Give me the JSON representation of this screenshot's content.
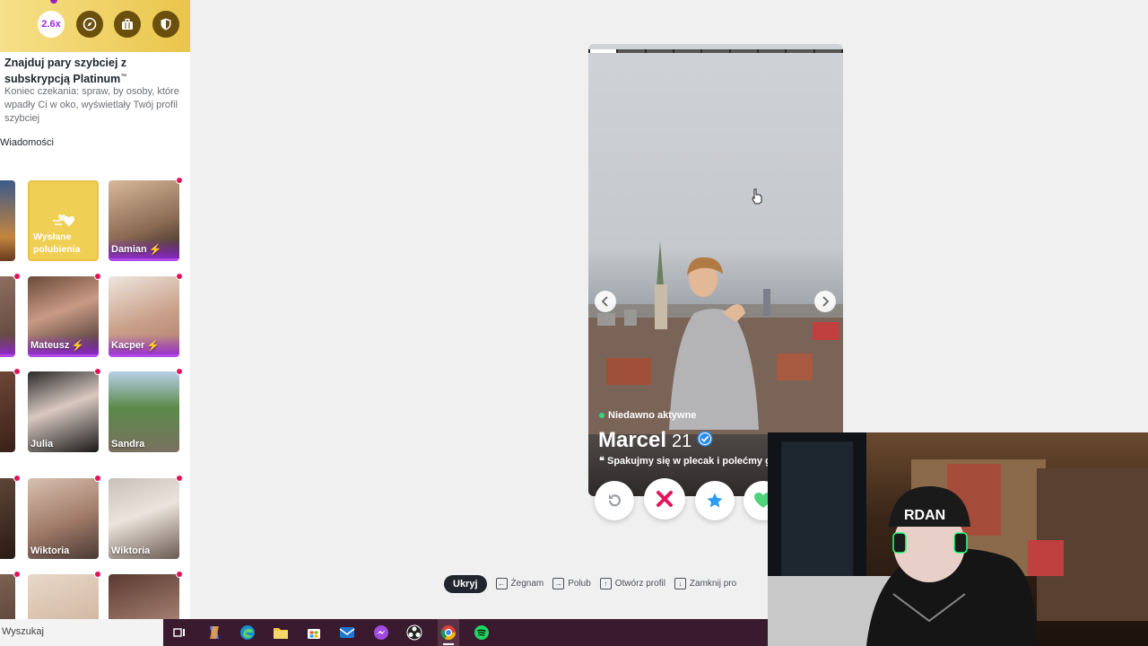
{
  "sidebar": {
    "boost_multiplier": "2.6x",
    "promo_title": "Znajduj pary szybciej z subskrypcją Platinum",
    "promo_trademark": "™",
    "promo_desc": "Koniec czekania: spraw, by osoby, które wpadły Ci w oko, wyświetlały Twój profil szybciej",
    "section_label": "Wiadomości",
    "liked_card_label_1": "Wysłane",
    "liked_card_label_2": "polubienia",
    "matches": [
      {
        "name": "Damian",
        "boost": true
      },
      {
        "name": "Mateusz",
        "boost": true
      },
      {
        "name": "Kacper",
        "boost": true
      },
      {
        "name": "Julia",
        "boost": false
      },
      {
        "name": "Sandra",
        "boost": false
      },
      {
        "name": "Wiktoria",
        "boost": false
      },
      {
        "name": "Wiktoria",
        "boost": false
      }
    ]
  },
  "profile": {
    "status": "Niedawno aktywne",
    "name": "Marcel",
    "age": "21",
    "verified": true,
    "bio": "Spakujmy się w plecak i polećmy g",
    "photo_count": 9,
    "current_photo_index": 1
  },
  "actions": [
    "rewind-button",
    "nope-button",
    "super-like-button",
    "like-button"
  ],
  "shortcuts": {
    "hide_label": "Ukryj",
    "items": [
      {
        "key": "←",
        "label": "Żegnam"
      },
      {
        "key": "→",
        "label": "Polub"
      },
      {
        "key": "↑",
        "label": "Otwórz profil"
      },
      {
        "key": "↓",
        "label": "Zamknij pro"
      }
    ]
  },
  "taskbar": {
    "search_placeholder": "Wyszukaj"
  },
  "colors": {
    "gold": "#f0cf55",
    "boost_purple": "#b04ae8",
    "nope": "#e3145c",
    "superlike": "#2a9df4",
    "like": "#4fd37a",
    "taskbar": "#3a1a2e"
  }
}
